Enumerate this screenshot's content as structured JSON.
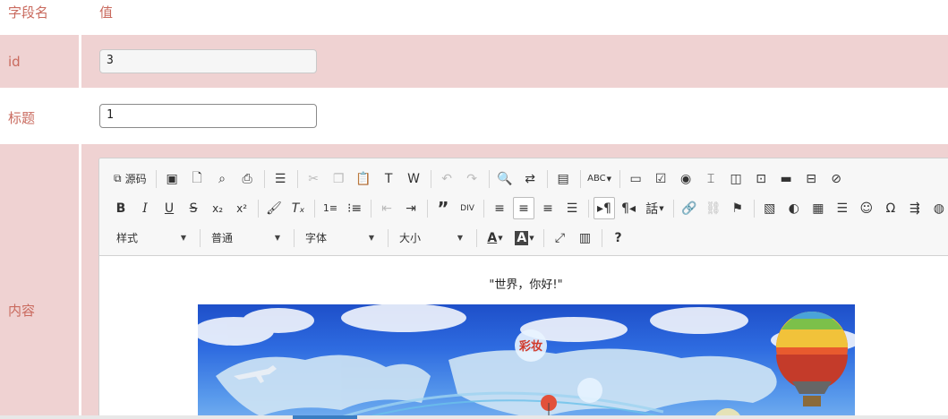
{
  "header": {
    "field_col": "字段名",
    "value_col": "值"
  },
  "rows": {
    "id": {
      "label": "id",
      "value": "3"
    },
    "title": {
      "label": "标题",
      "value": "1"
    },
    "content": {
      "label": "内容"
    }
  },
  "editor": {
    "source_label": "源码",
    "combos": {
      "style": "样式",
      "format": "普通",
      "font": "字体",
      "size": "大小"
    },
    "icons_row1": [
      "code-icon",
      "save-icon",
      "new-page-icon",
      "preview-icon",
      "print-icon",
      "templates-icon",
      "cut-icon",
      "copy-icon",
      "paste-icon",
      "paste-text-icon",
      "paste-word-icon",
      "undo-icon",
      "redo-icon",
      "find-icon",
      "replace-icon",
      "select-all-icon",
      "spellcheck-icon",
      "form-icon",
      "checkbox-icon",
      "radio-icon",
      "textfield-icon",
      "textarea-icon",
      "select-icon",
      "button-icon",
      "image-button-icon",
      "hidden-field-icon"
    ],
    "icons_row2": [
      "bold-icon",
      "italic-icon",
      "underline-icon",
      "strike-icon",
      "subscript-icon",
      "superscript-icon",
      "copy-format-icon",
      "remove-format-icon",
      "numbered-list-icon",
      "bulleted-list-icon",
      "outdent-icon",
      "indent-icon",
      "blockquote-icon",
      "create-div-icon",
      "align-left-icon",
      "align-center-icon",
      "align-right-icon",
      "justify-icon",
      "ltr-icon",
      "rtl-icon",
      "language-icon",
      "link-icon",
      "unlink-icon",
      "anchor-icon",
      "image-icon",
      "flash-icon",
      "table-icon",
      "horizontal-rule-icon",
      "smiley-icon",
      "special-char-icon",
      "page-break-icon",
      "iframe-icon"
    ],
    "icons_row3": [
      "text-color-icon",
      "bg-color-icon",
      "maximize-icon",
      "show-blocks-icon",
      "help-icon"
    ],
    "body": {
      "greeting": "\"世界，你好!\"",
      "banner_tag": "彩妆"
    }
  },
  "colors": {
    "row_bg": "#efd2d2",
    "label": "#c96a5e",
    "accent": "#3b7ec3"
  }
}
